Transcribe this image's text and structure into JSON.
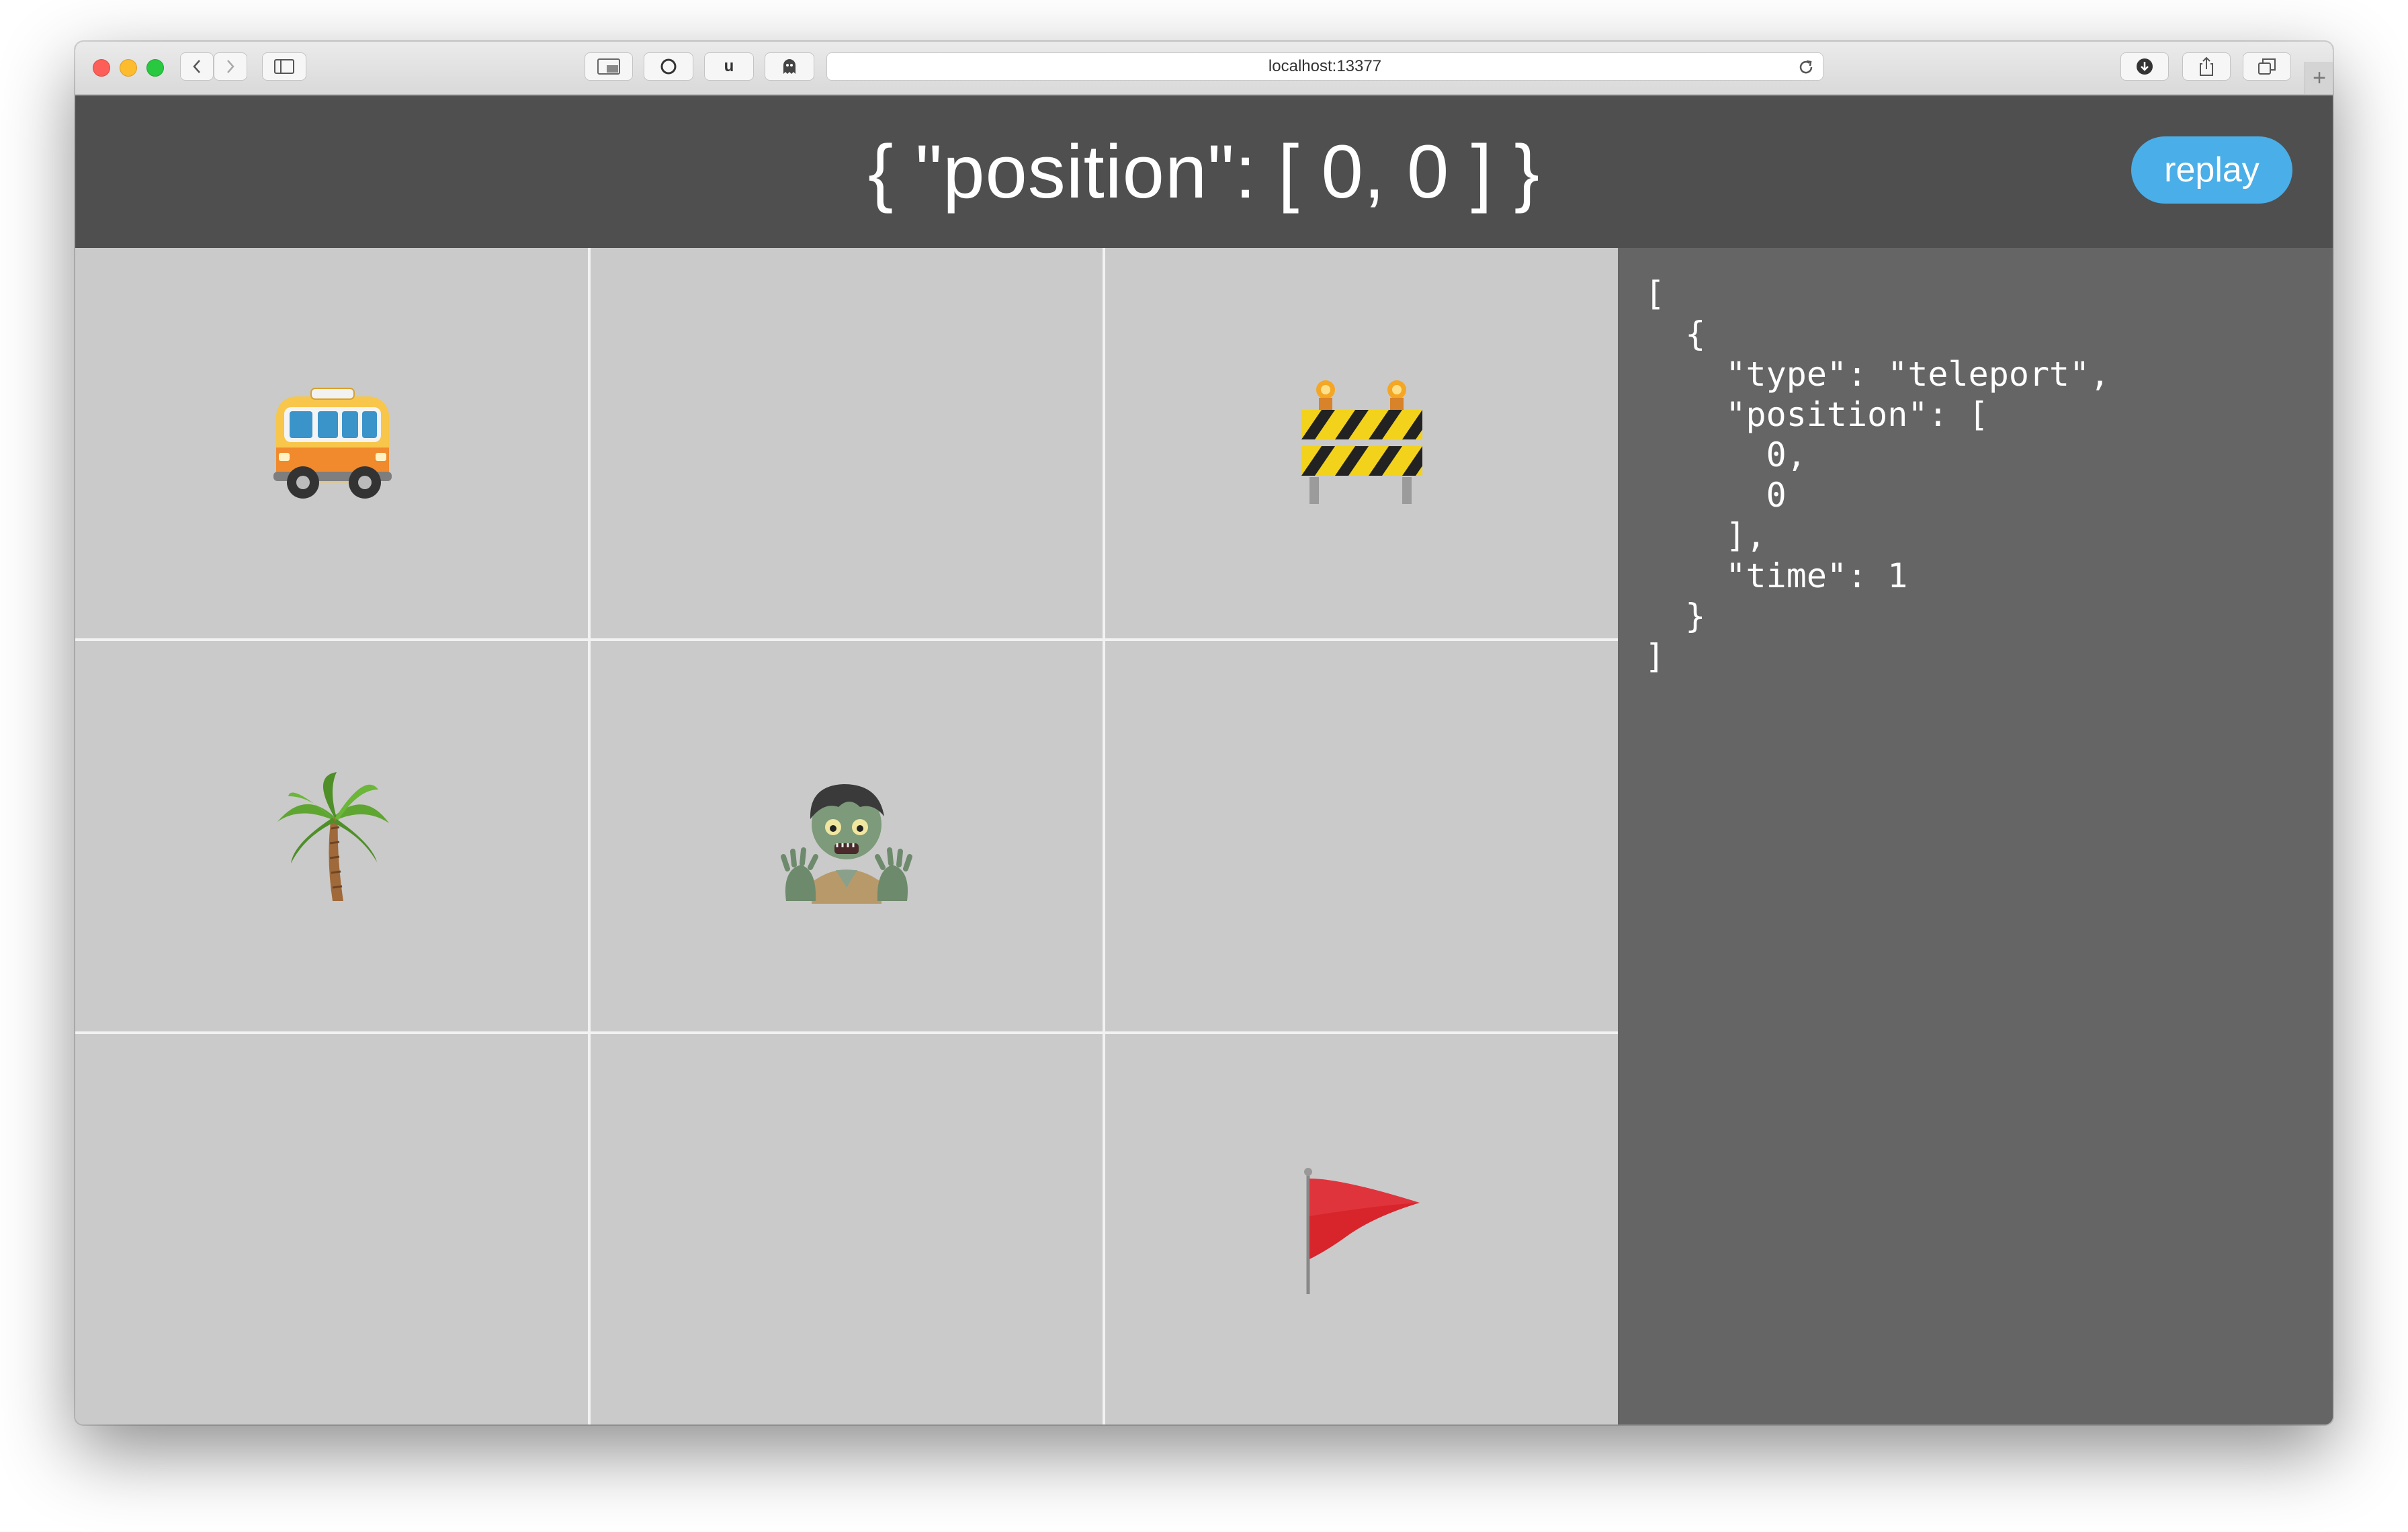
{
  "browser": {
    "url": "localhost:13377",
    "icons": [
      "back-icon",
      "forward-icon",
      "sidebar-icon",
      "picture-in-picture-icon",
      "circle-icon",
      "u-extension-icon",
      "ghost-icon",
      "reload-icon",
      "download-icon",
      "share-icon",
      "tabs-icon",
      "plus-icon"
    ]
  },
  "header": {
    "title": "{ \"position\": [ 0, 0 ] }",
    "replay_label": "replay"
  },
  "grid": {
    "rows": 3,
    "cols": 3,
    "cells": [
      [
        "bus-icon",
        "",
        "construction-barrier-icon"
      ],
      [
        "palm-tree-icon",
        "zombie-icon",
        ""
      ],
      [
        "",
        "",
        "red-flag-icon"
      ]
    ]
  },
  "log": {
    "text": "[\n  {\n    \"type\": \"teleport\",\n    \"position\": [\n      0,\n      0\n    ],\n    \"time\": 1\n  }\n]"
  },
  "colors": {
    "header_bg": "#4f4f4f",
    "cell_bg": "#cacaca",
    "panel_bg": "#656565",
    "accent": "#4aaee8"
  }
}
